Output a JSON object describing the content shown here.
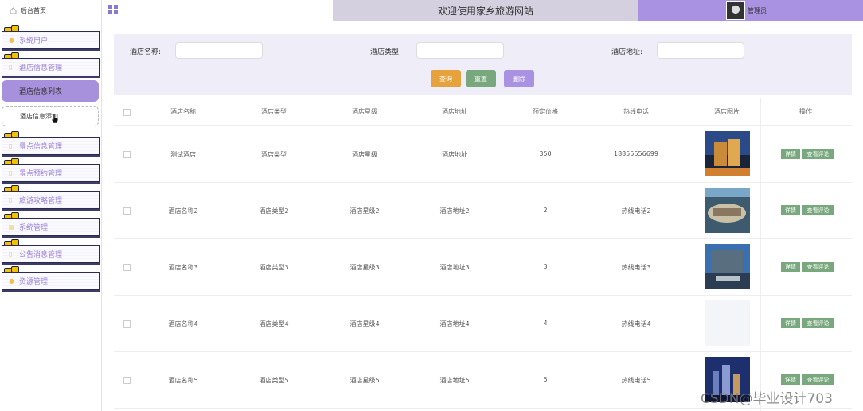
{
  "sidebar": {
    "home": "后台首页",
    "items": [
      {
        "label": "系统用户"
      },
      {
        "label": "酒店信息管理"
      },
      {
        "label": "景点信息管理"
      },
      {
        "label": "景点预约管理"
      },
      {
        "label": "旅游攻略管理"
      },
      {
        "label": "系统管理"
      },
      {
        "label": "公告消息管理"
      },
      {
        "label": "资源管理"
      }
    ],
    "sub_active": "酒店信息列表",
    "sub_normal": "酒店信息添加"
  },
  "header": {
    "welcome": "欢迎使用家乡旅游网站",
    "username": "管理员"
  },
  "search": {
    "name_label": "酒店名称:",
    "type_label": "酒店类型:",
    "addr_label": "酒店地址:",
    "query_btn": "查询",
    "reset_btn": "重置",
    "delete_btn": "删除"
  },
  "table": {
    "headers": [
      "酒店名称",
      "酒店类型",
      "酒店星级",
      "酒店地址",
      "预定价格",
      "热线电话",
      "酒店图片",
      "操作"
    ],
    "rows": [
      {
        "name": "测试酒店",
        "type": "酒店类型",
        "star": "酒店星级",
        "addr": "酒店地址",
        "price": "350",
        "phone": "18855556699"
      },
      {
        "name": "酒店名称2",
        "type": "酒店类型2",
        "star": "酒店星级2",
        "addr": "酒店地址2",
        "price": "2",
        "phone": "热线电话2"
      },
      {
        "name": "酒店名称3",
        "type": "酒店类型3",
        "star": "酒店星级3",
        "addr": "酒店地址3",
        "price": "3",
        "phone": "热线电话3"
      },
      {
        "name": "酒店名称4",
        "type": "酒店类型4",
        "star": "酒店星级4",
        "addr": "酒店地址4",
        "price": "4",
        "phone": "热线电话4"
      },
      {
        "name": "酒店名称5",
        "type": "酒店类型5",
        "star": "酒店星级5",
        "addr": "酒店地址5",
        "price": "5",
        "phone": "热线电话5"
      }
    ],
    "detail_btn": "详情",
    "comment_btn": "查看评论"
  },
  "watermark": "CSDN@毕业设计703",
  "colors": {
    "accent": "#a992e2",
    "query": "#e6a23c",
    "reset": "#7aa87e",
    "panel": "#efedf8"
  }
}
